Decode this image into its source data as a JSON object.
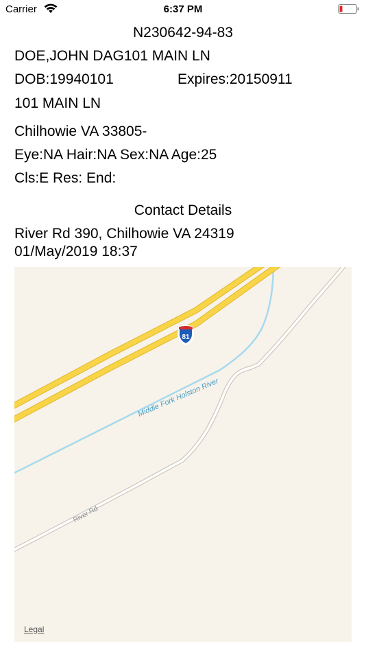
{
  "status_bar": {
    "carrier": "Carrier",
    "time": "6:37 PM"
  },
  "license": {
    "number": "N230642-94-83",
    "name_line": "DOE,JOHN DAG101 MAIN LN",
    "dob": "DOB:19940101",
    "expires": "Expires:20150911",
    "address_line": "101 MAIN LN",
    "city_line": "Chilhowie VA 33805-",
    "physical": "Eye:NA Hair:NA Sex:NA Age:25",
    "class_line": "Cls:E Res: End:"
  },
  "contact": {
    "heading": "Contact Details",
    "address": "River Rd 390, Chilhowie VA 24319",
    "timestamp": "01/May/2019 18:37"
  },
  "map": {
    "highway_shield": "81",
    "river_label": "Middle Fork Holston River",
    "road_label": "River Rd",
    "legal": "Legal",
    "colors": {
      "background": "#f7f3ea",
      "highway": "#f8d548",
      "river": "#a7d9ee",
      "road": "#ffffff"
    }
  }
}
